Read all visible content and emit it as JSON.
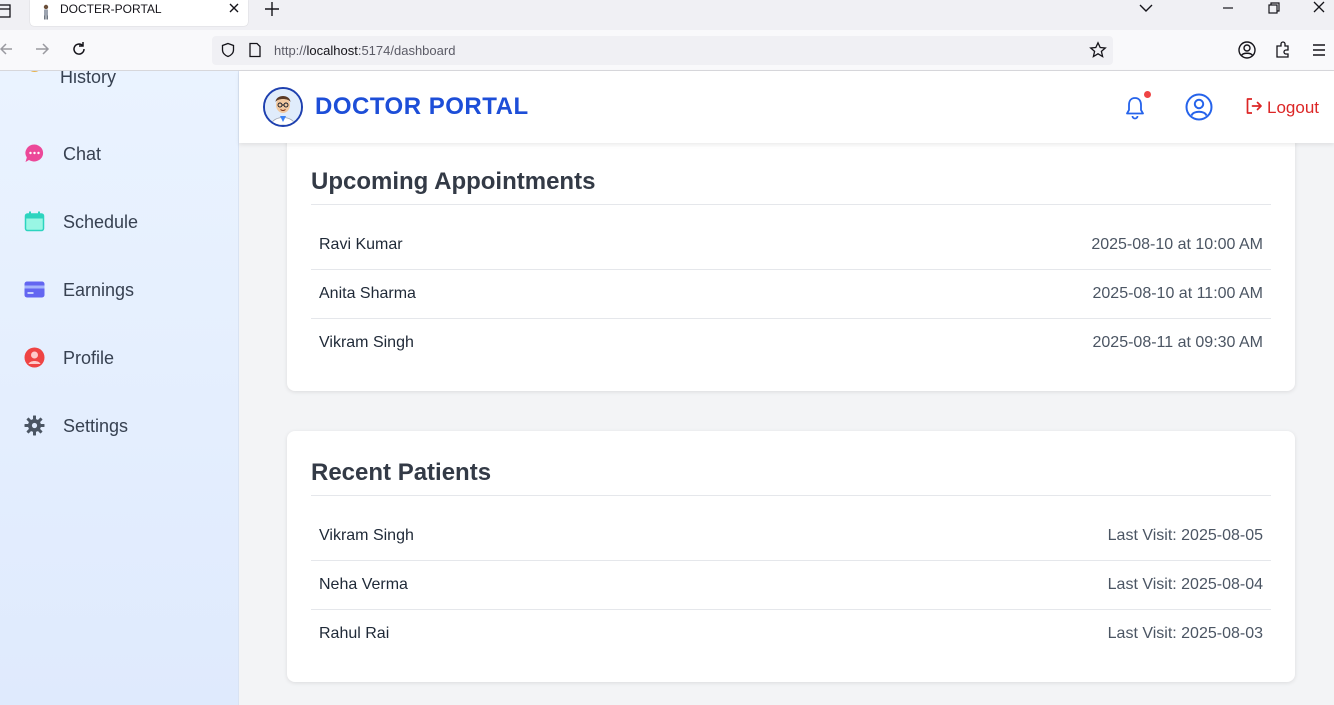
{
  "browser": {
    "tab_title": "DOCTER-PORTAL",
    "url_prefix": "http://",
    "url_host": "localhost",
    "url_rest": ":5174/dashboard"
  },
  "sidebar": {
    "items": [
      {
        "label": "History",
        "icon": "history-icon",
        "color": "#e8b14a"
      },
      {
        "label": "Chat",
        "icon": "chat-icon",
        "color": "#ec4899"
      },
      {
        "label": "Schedule",
        "icon": "calendar-icon",
        "color": "#2dd4bf"
      },
      {
        "label": "Earnings",
        "icon": "credit-card-icon",
        "color": "#6366f1"
      },
      {
        "label": "Profile",
        "icon": "user-circle-icon",
        "color": "#ef4444"
      },
      {
        "label": "Settings",
        "icon": "gear-icon",
        "color": "#4b5563"
      }
    ]
  },
  "header": {
    "brand": "DOCTOR PORTAL",
    "logout_label": "Logout",
    "brand_color": "#1d4ed8",
    "logout_color": "#dc2626",
    "notification_dot_color": "#ef4444"
  },
  "appointments": {
    "title": "Upcoming Appointments",
    "rows": [
      {
        "name": "Ravi Kumar",
        "time": "2025-08-10 at 10:00 AM"
      },
      {
        "name": "Anita Sharma",
        "time": "2025-08-10 at 11:00 AM"
      },
      {
        "name": "Vikram Singh",
        "time": "2025-08-11 at 09:30 AM"
      }
    ]
  },
  "patients": {
    "title": "Recent Patients",
    "rows": [
      {
        "name": "Vikram Singh",
        "last_visit": "Last Visit: 2025-08-05"
      },
      {
        "name": "Neha Verma",
        "last_visit": "Last Visit: 2025-08-04"
      },
      {
        "name": "Rahul Rai",
        "last_visit": "Last Visit: 2025-08-03"
      }
    ]
  }
}
